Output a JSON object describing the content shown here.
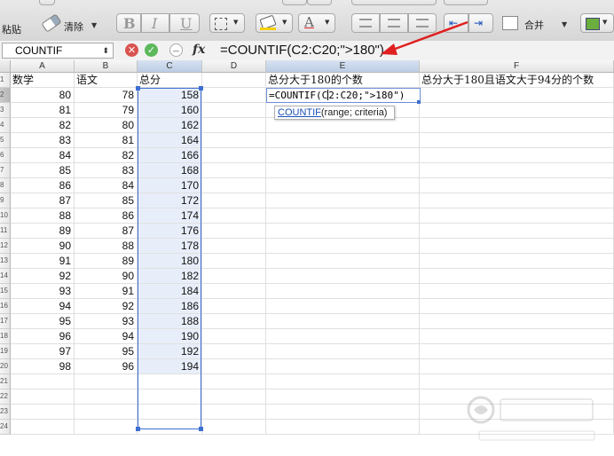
{
  "toolbar": {
    "paste_label": "粘贴",
    "clear_label": "清除",
    "merge_label": "合并",
    "bold": "B",
    "italic": "I",
    "underline": "U",
    "font_color_letter": "A"
  },
  "formula_bar": {
    "name_box": "COUNTIF",
    "fx": "fx",
    "formula": "=COUNTIF(C2:C20;\">180\")"
  },
  "columns": [
    "A",
    "B",
    "C",
    "D",
    "E",
    "F"
  ],
  "rows": [
    "1",
    "2",
    "3",
    "4",
    "5",
    "6",
    "7",
    "8",
    "9",
    "10",
    "11",
    "12",
    "13",
    "14",
    "15",
    "16",
    "17",
    "18",
    "19",
    "20",
    "21",
    "22",
    "23",
    "24"
  ],
  "headers": {
    "a": "数学",
    "b": "语文",
    "c": "总分",
    "e": "总分大于180的个数",
    "f": "总分大于180且语文大于94分的个数"
  },
  "table": [
    [
      80,
      78,
      158
    ],
    [
      81,
      79,
      160
    ],
    [
      82,
      80,
      162
    ],
    [
      83,
      81,
      164
    ],
    [
      84,
      82,
      166
    ],
    [
      85,
      83,
      168
    ],
    [
      86,
      84,
      170
    ],
    [
      87,
      85,
      172
    ],
    [
      88,
      86,
      174
    ],
    [
      89,
      87,
      176
    ],
    [
      90,
      88,
      178
    ],
    [
      91,
      89,
      180
    ],
    [
      92,
      90,
      182
    ],
    [
      93,
      91,
      184
    ],
    [
      94,
      92,
      186
    ],
    [
      95,
      93,
      188
    ],
    [
      96,
      94,
      190
    ],
    [
      97,
      95,
      192
    ],
    [
      98,
      96,
      194
    ]
  ],
  "edit_cell": {
    "prefix": "=COUNTIF(C",
    "suffix": "2:C20;\">180\")"
  },
  "tooltip": {
    "fn": "COUNTIF",
    "args": "(range; criteria)"
  },
  "colors": {
    "selection": "#3d6fd2",
    "arrow": "#e02020",
    "link": "#1a4fb8"
  }
}
